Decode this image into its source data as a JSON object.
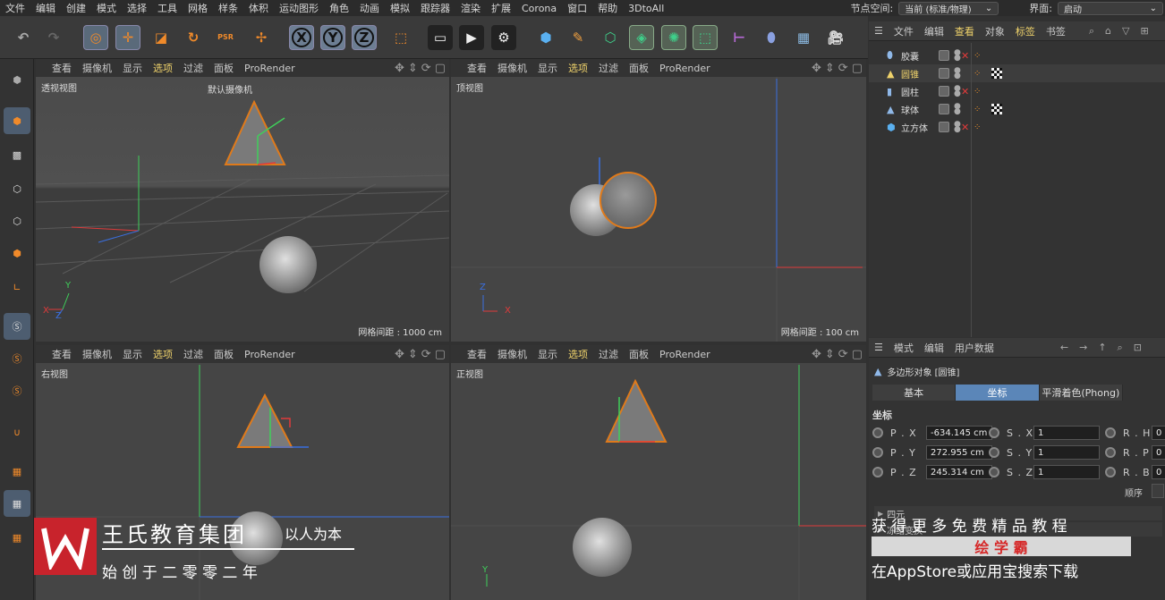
{
  "menu": [
    "文件",
    "编辑",
    "创建",
    "模式",
    "选择",
    "工具",
    "网格",
    "样条",
    "体积",
    "运动图形",
    "角色",
    "动画",
    "模拟",
    "跟踪器",
    "渲染",
    "扩展",
    "Corona",
    "窗口",
    "帮助",
    "3DtoAll"
  ],
  "node_space": {
    "label": "节点空间:",
    "value": "当前 (标准/物理)"
  },
  "interface": {
    "label": "界面:",
    "value": "启动"
  },
  "toolbar": {
    "axis_x": "X",
    "axis_y": "Y",
    "axis_z": "Z",
    "psr": "PSR"
  },
  "viewport_menu": [
    "查看",
    "摄像机",
    "显示",
    "选项",
    "过滤",
    "面板",
    "ProRender"
  ],
  "viewports": {
    "perspective": {
      "name": "透视视图",
      "camera": "默认摄像机",
      "grid": "网格间距 : 1000 cm"
    },
    "top": {
      "name": "顶视图",
      "grid": "网格间距 : 100 cm"
    },
    "right": {
      "name": "右视图"
    },
    "front": {
      "name": "正视图"
    }
  },
  "axes": {
    "x": "X",
    "y": "Y",
    "z": "Z"
  },
  "object_manager": {
    "menu": [
      "文件",
      "编辑",
      "查看",
      "对象",
      "标签",
      "书签"
    ],
    "objects": [
      {
        "name": "胶囊",
        "icon": "capsule-icon",
        "color": "#8fb8e8",
        "selected": false
      },
      {
        "name": "圆锥",
        "icon": "cone-icon",
        "color": "#f0d36b",
        "selected": true
      },
      {
        "name": "圆柱",
        "icon": "cylinder-icon",
        "color": "#8fb8e8",
        "selected": false
      },
      {
        "name": "球体",
        "icon": "sphere-icon",
        "color": "#8fb8e8",
        "selected": false
      },
      {
        "name": "立方体",
        "icon": "cube-icon",
        "color": "#8fb8e8",
        "selected": false
      }
    ]
  },
  "attribute_manager": {
    "menu": [
      "模式",
      "编辑",
      "用户数据"
    ],
    "title": "多边形对象 [圆锥]",
    "tabs": [
      "基本",
      "坐标",
      "平滑着色(Phong)"
    ],
    "active_tab": "坐标",
    "section": "坐标",
    "pos": [
      {
        "label": "P . X",
        "value": "-634.145 cm"
      },
      {
        "label": "P . Y",
        "value": "272.955 cm"
      },
      {
        "label": "P . Z",
        "value": "245.314 cm"
      }
    ],
    "scale": [
      {
        "label": "S . X",
        "value": "1"
      },
      {
        "label": "S . Y",
        "value": "1"
      },
      {
        "label": "S . Z",
        "value": "1"
      }
    ],
    "rot": [
      {
        "label": "R . H",
        "value": "0"
      },
      {
        "label": "R . P",
        "value": "0"
      },
      {
        "label": "R . B",
        "value": "0"
      }
    ],
    "order_label": "顺序",
    "quaternion": "四元",
    "freeze": "冻结变换"
  },
  "watermark": {
    "company": "王氏教育集团",
    "slogan": "以人为本",
    "founded": "始 创 于 二 零 零 二 年",
    "promo_line": "获 得 更 多 免 费 精 品 教 程",
    "app_name": "绘 学 霸",
    "store_line": "在AppStore或应用宝搜索下载"
  },
  "colors": {
    "accent": "#e07a1a",
    "selected_tab": "#5b86b8",
    "axis_x": "#e03b3b",
    "axis_y": "#3fcf5a",
    "axis_z": "#3a6fe0"
  }
}
